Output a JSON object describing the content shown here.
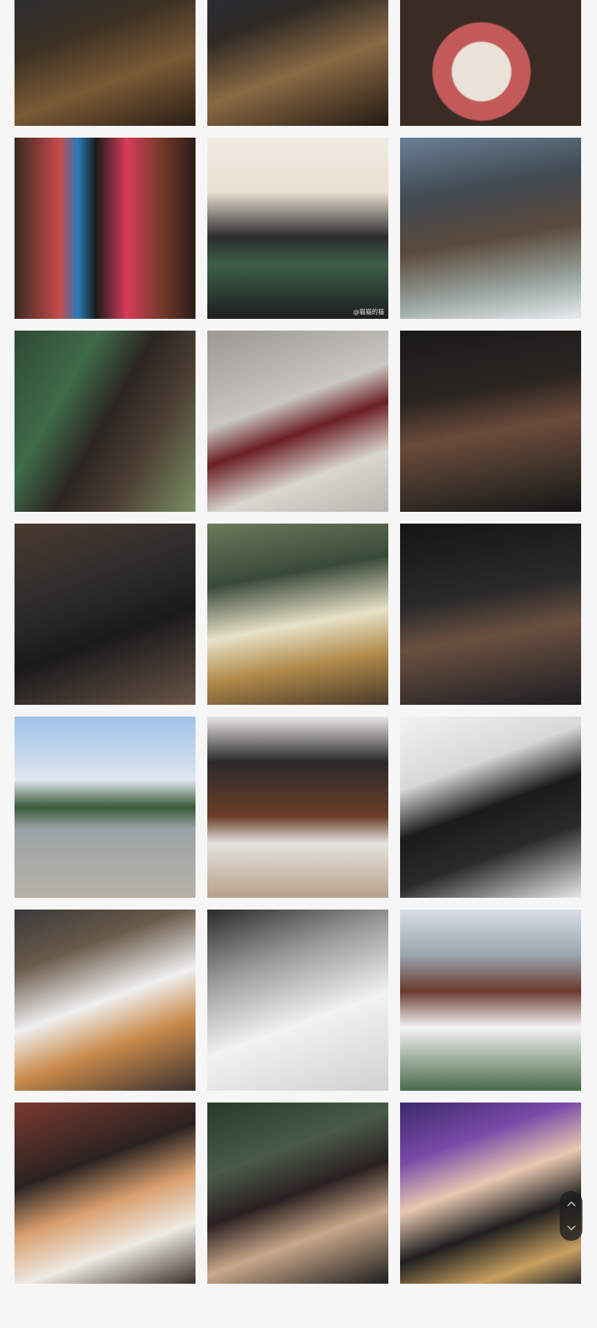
{
  "gallery": {
    "photos": [
      {
        "icon": "photo-man-sitting-night-city",
        "caption": ""
      },
      {
        "icon": "photo-man-drinking-night-city",
        "caption": ""
      },
      {
        "icon": "photo-cat-in-lap",
        "caption": ""
      },
      {
        "icon": "photo-two-men-floral-jackets",
        "caption": ""
      },
      {
        "icon": "photo-selfie-headband-mask",
        "caption": "@猫猫的猫"
      },
      {
        "icon": "photo-two-men-selfie-outdoors",
        "caption": ""
      },
      {
        "icon": "photo-man-with-guitar",
        "caption": ""
      },
      {
        "icon": "photo-wine-glasses",
        "caption": ""
      },
      {
        "icon": "photo-man-dining-night",
        "caption": ""
      },
      {
        "icon": "photo-mirror-selfie-gym",
        "caption": ""
      },
      {
        "icon": "photo-man-cafe-chair",
        "caption": ""
      },
      {
        "icon": "photo-man-eating-night",
        "caption": ""
      },
      {
        "icon": "photo-man-by-lake",
        "caption": ""
      },
      {
        "icon": "photo-two-men-on-sofa",
        "caption": ""
      },
      {
        "icon": "photo-two-men-suits",
        "caption": ""
      },
      {
        "icon": "photo-man-holding-cat",
        "caption": ""
      },
      {
        "icon": "photo-monochrome-selfie",
        "caption": ""
      },
      {
        "icon": "photo-two-men-toy-guns",
        "caption": ""
      },
      {
        "icon": "photo-man-cuddling-cat",
        "caption": ""
      },
      {
        "icon": "photo-two-men-smiling",
        "caption": ""
      },
      {
        "icon": "photo-two-men-purple-light",
        "caption": ""
      }
    ]
  },
  "scroll_widget": {
    "up_icon": "chevron-up-icon",
    "down_icon": "chevron-down-icon"
  }
}
